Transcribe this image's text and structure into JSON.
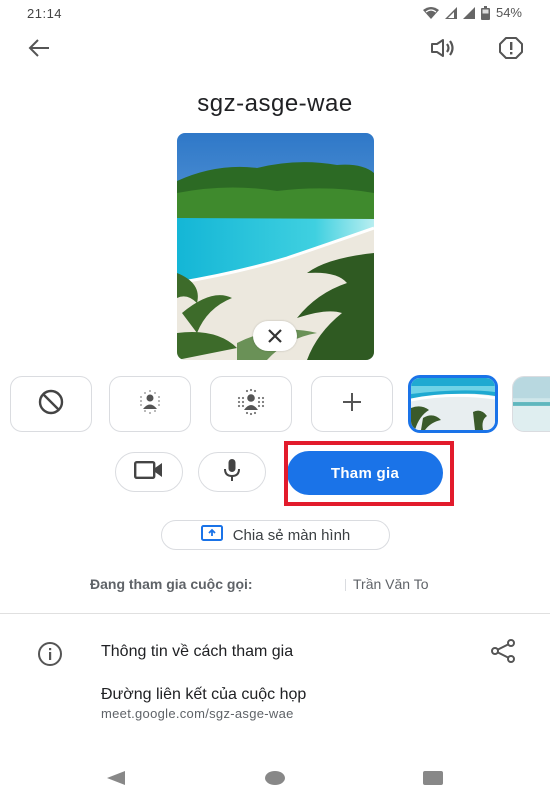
{
  "status_bar": {
    "time": "21:14",
    "battery": "54%",
    "icons": [
      "wifi-icon",
      "signal-icon",
      "signal-icon",
      "battery-icon"
    ]
  },
  "app_bar": {
    "back_icon": "arrow-left-icon",
    "speaker_icon": "speaker-icon",
    "report_icon": "report-icon"
  },
  "meeting": {
    "code": "sgz-asge-wae"
  },
  "preview": {
    "close_icon": "close-icon"
  },
  "effects": [
    {
      "name": "no-effect",
      "icon": "block-icon"
    },
    {
      "name": "slight-blur",
      "icon": "blur-person-icon"
    },
    {
      "name": "blur",
      "icon": "blur-person-strong-icon"
    },
    {
      "name": "add-background",
      "icon": "plus-icon"
    },
    {
      "name": "beach-background",
      "selected": true
    },
    {
      "name": "sea-background",
      "selected": false
    }
  ],
  "controls": {
    "camera_icon": "videocam-icon",
    "mic_icon": "mic-icon",
    "join_label": "Tham gia"
  },
  "share_screen": {
    "label": "Chia sẻ màn hình",
    "icon": "present-screen-icon"
  },
  "joined": {
    "label": "Đang tham gia cuộc gọi:",
    "name": "Trần Văn To"
  },
  "join_info": {
    "title": "Thông tin về cách tham gia",
    "link_label": "Đường liên kết của cuộc họp",
    "link_url": "meet.google.com/sgz-asge-wae"
  },
  "colors": {
    "accent": "#1a73e8",
    "highlight": "#e21b2c"
  },
  "nav_bar": {
    "buttons": [
      "back",
      "home",
      "recents"
    ]
  }
}
